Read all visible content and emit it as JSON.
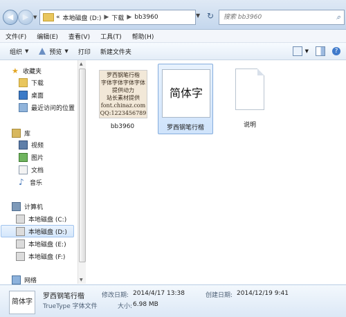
{
  "address": {
    "overflow": "«",
    "drive": "本地磁盘 (D:)",
    "folder": "下载",
    "current": "bb3960"
  },
  "search": {
    "placeholder": "搜索 bb3960"
  },
  "menu": [
    "文件(F)",
    "编辑(E)",
    "查看(V)",
    "工具(T)",
    "帮助(H)"
  ],
  "toolbar": {
    "organize": "组织",
    "preview": "预览",
    "print": "打印",
    "new_folder": "新建文件夹"
  },
  "sidebar": {
    "favorites": "收藏夹",
    "downloads": "下载",
    "desktop": "桌面",
    "recent": "最近访问的位置",
    "libraries": "库",
    "videos": "视频",
    "pictures": "图片",
    "documents": "文档",
    "music": "音乐",
    "computer": "计算机",
    "drive_c": "本地磁盘 (C:)",
    "drive_d": "本地磁盘 (D:)",
    "drive_e": "本地磁盘 (E:)",
    "drive_f": "本地磁盘 (F:)",
    "network": "网络"
  },
  "files": [
    {
      "name": "bb3960",
      "thumbnail_lines": [
        "罗西钢笔行楷",
        "字体字体字体字体",
        "提供动力",
        "站长素材提供",
        "font.chinaz.com",
        "QQ:1223456789"
      ]
    },
    {
      "name": "罗西钢笔行楷",
      "preview_text": "简体字"
    },
    {
      "name": "说明"
    }
  ],
  "details": {
    "title": "罗西钢笔行楷",
    "type": "TrueType 字体文件",
    "modified_label": "修改日期:",
    "modified_value": "2014/4/17 13:38",
    "created_label": "创建日期:",
    "created_value": "2014/12/19 9:41",
    "size_label": "大小:",
    "size_value": "6.98 MB",
    "icon_text": "简体字"
  }
}
